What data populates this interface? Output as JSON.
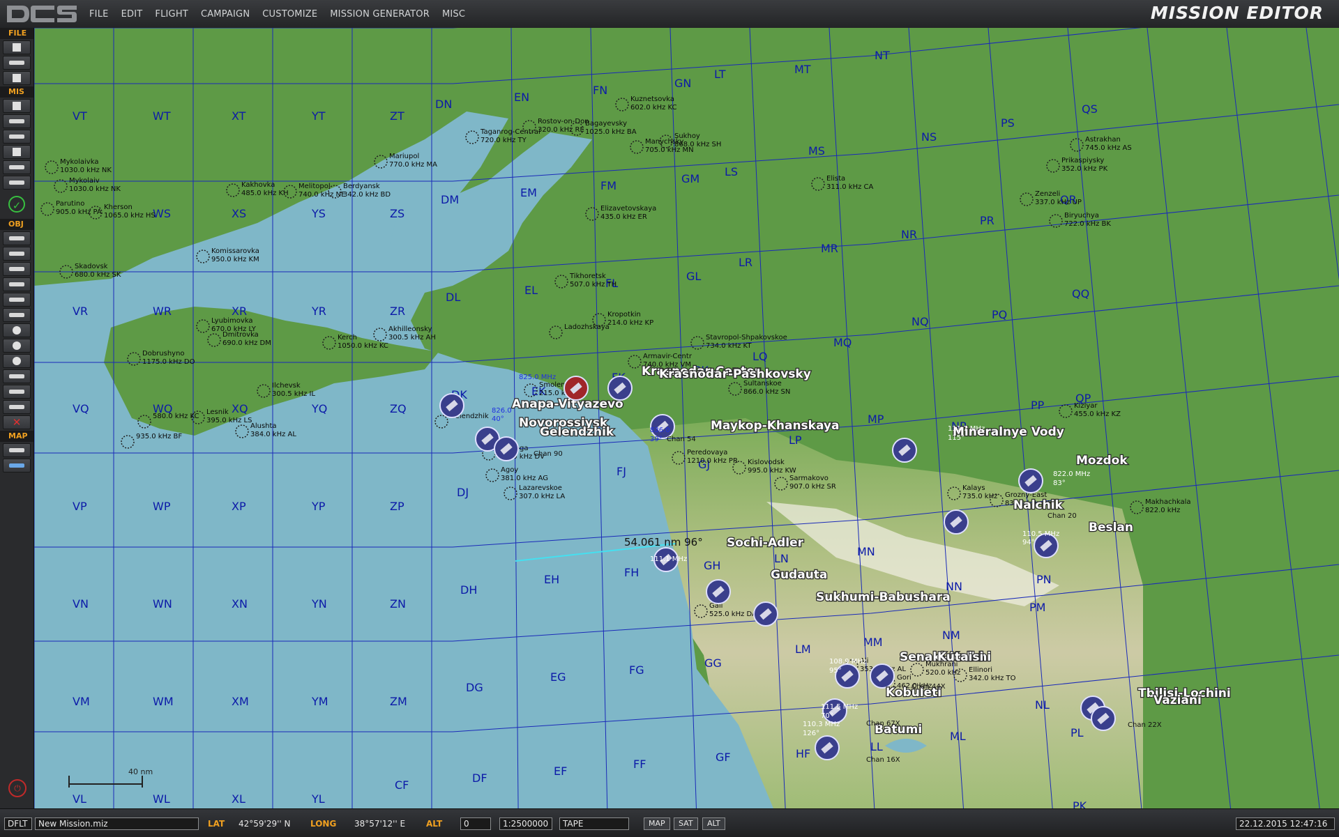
{
  "app": {
    "title": "MISSION EDITOR"
  },
  "menu": [
    "FILE",
    "EDIT",
    "FLIGHT",
    "CAMPAIGN",
    "CUSTOMIZE",
    "MISSION GENERATOR",
    "MISC"
  ],
  "sidebar": {
    "file": "FILE",
    "mis": "MIS",
    "obj": "OBJ",
    "map": "MAP"
  },
  "map": {
    "grid_labels": [
      "VT",
      "WT",
      "XT",
      "YT",
      "ZT",
      "DN",
      "EN",
      "FN",
      "GN",
      "LT",
      "MT",
      "NT",
      "WS",
      "XS",
      "YS",
      "ZS",
      "DM",
      "EM",
      "FM",
      "GM",
      "LS",
      "MS",
      "NS",
      "PS",
      "QS",
      "VR",
      "WR",
      "XR",
      "YR",
      "ZR",
      "DL",
      "EL",
      "FL",
      "GL",
      "LR",
      "MR",
      "NR",
      "PR",
      "QR",
      "VQ",
      "WQ",
      "XQ",
      "YQ",
      "ZQ",
      "DK",
      "EK",
      "FK",
      "GK",
      "LQ",
      "MQ",
      "NQ",
      "PQ",
      "QQ",
      "VP",
      "WP",
      "XP",
      "YP",
      "ZP",
      "DJ",
      "FJ",
      "GJ",
      "LP",
      "MP",
      "NP",
      "PP",
      "QP",
      "VN",
      "WN",
      "XN",
      "YN",
      "ZN",
      "DH",
      "EH",
      "FH",
      "GH",
      "LN",
      "MN",
      "NN",
      "PN",
      "VM",
      "WM",
      "XM",
      "YM",
      "ZM",
      "DG",
      "EG",
      "FG",
      "GG",
      "LM",
      "MM",
      "NM",
      "PM",
      "VL",
      "WL",
      "XL",
      "YL",
      "CF",
      "DF",
      "EF",
      "FF",
      "GF",
      "HF",
      "LL",
      "ML",
      "NL",
      "PL",
      "PK"
    ],
    "navaids": [
      "Mykolaivka 1030.0 kHz NK",
      "Mykolaiv 1030.0 kHz NK",
      "Parutino 905.0 kHz PA",
      "Kherson 1065.0 kHz HS",
      "Kakhovka 485.0 kHz KH",
      "Melitopol 740.0 kHz NE",
      "Berdyansk 342.0 kHz BD",
      "Mariupol 770.0 kHz MA",
      "Taganrog-Central 720.0 kHz TY",
      "Rostov-on-Don 320.0 kHz RE",
      "Bagayevsky 1025.0 kHz BA",
      "Kuznetsovka 602.0 kHz KC",
      "Sukhoy 868.0 kHz SH",
      "Manychsky 705.0 kHz MN",
      "Skadovsk 680.0 kHz SK",
      "Komissarovka 950.0 kHz KM",
      "Lyubimovka 670.0 kHz LY",
      "Dmitrovka 690.0 kHz DM",
      "Dobrushyno 1175.0 kHz DO",
      "Kerch 1050.0 kHz KC",
      "Akhilleonsky 300.5 kHz AH",
      "Ilchevsk 300.5 kHz IL",
      "Lesnik 395.0 kHz LS",
      "Alushta 384.0 kHz AL",
      "580.0 kHz KC",
      "935.0 kHz BF",
      "Tikhoretsk 507.0 kHz TH",
      "Kropotkin 214.0 kHz KP",
      "Ladozhskaya",
      "Armavir-Centr 740.0 kHz VM",
      "Stavropol-Shpakovskoe 734.0 kHz KT",
      "Sultanskoe 866.0 kHz SN",
      "Smolenskaya 215.0 kHz SM",
      "Dzhubga 420.0 kHz DV",
      "Agoy 381.0 kHz AG",
      "Lazarevskoe 307.0 kHz LA",
      "Peredovaya 1210.0 kHz PR",
      "Kislovodsk 995.0 kHz KW",
      "Sarmakovo 907.0 kHz SR",
      "Kalays 735.0 kHz",
      "Grozny-East 830.0 kHz WK",
      "Kizlyar 455.0 kHz KZ",
      "Elista 311.0 kHz CA",
      "Astrakhan 745.0 kHz AS",
      "Prikaspiysky 352.0 kHz PK",
      "Zenzeli 337.0 kHz UP",
      "Biryuchya 722.0 kHz BK",
      "Makhachkala 822.0 kHz",
      "Gali 525.0 kHz DA",
      "Ali 353.0 kHz AL",
      "Gori 462.0 kHz",
      "Mukhrani 520.0 kHz",
      "Ellinori 342.0 kHz TO",
      "Elizavetovskaya 435.0 kHz ER",
      "Gelendzhik"
    ],
    "airports": [
      "Anapa-Vityazevo",
      "Krasnodar-Center",
      "Krasnodar-Pashkovsky",
      "Novorossiysk",
      "Gelendzhik",
      "Maykop-Khanskaya",
      "Mineralnye Vody",
      "Mozdok",
      "Nalchik",
      "Beslan",
      "Sochi-Adler",
      "Gudauta",
      "Sukhumi-Babushara",
      "Senaki-Kolkhi",
      "Kutaisi",
      "Kobuleti",
      "Batumi",
      "Tbilisi-Lochini",
      "Vaziani"
    ],
    "freqs": [
      "825.0 MHz",
      "826.0",
      "40°",
      "836.0",
      "39°",
      "111.7 MHz",
      "115°",
      "822.0 MHz",
      "83°",
      "110.5 MHz",
      "94°",
      "111.1 MHz",
      "108.9 MHz",
      "95°",
      "111.5 MHz",
      "70°",
      "110.3 MHz",
      "126°",
      "Chan 20",
      "Chan 44X",
      "Chan 67X",
      "Chan 16X",
      "Chan 22X",
      "Chan 90",
      "Chan 54"
    ],
    "measurement": "54.061 nm 96°",
    "scale_label": "40 nm"
  },
  "bottom": {
    "profile": "DFLT",
    "filename": "New Mission.miz",
    "lat_label": "LAT",
    "lat_value": "42°59'29'' N",
    "long_label": "LONG",
    "long_value": "38°57'12'' E",
    "alt_label": "ALT",
    "alt_value": "0",
    "scale": "1:2500000",
    "tape": "TAPE",
    "buttons": [
      "MAP",
      "SAT",
      "ALT"
    ],
    "datetime": "22.12.2015 12:47:16"
  }
}
